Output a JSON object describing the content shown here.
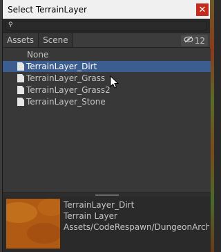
{
  "window": {
    "title": "Select TerrainLayer",
    "close_glyph": "✕"
  },
  "search": {
    "icon": "search-icon",
    "value": "",
    "placeholder": ""
  },
  "tabs": [
    {
      "label": "Assets",
      "active": true
    },
    {
      "label": "Scene",
      "active": false
    }
  ],
  "visibility": {
    "icon": "eye-slash-icon",
    "count": "12"
  },
  "items": [
    {
      "label": "None",
      "has_icon": false,
      "selected": false
    },
    {
      "label": "TerrainLayer_Dirt",
      "has_icon": true,
      "selected": true
    },
    {
      "label": "TerrainLayer_Grass",
      "has_icon": true,
      "selected": false
    },
    {
      "label": "TerrainLayer_Grass2",
      "has_icon": true,
      "selected": false
    },
    {
      "label": "TerrainLayer_Stone",
      "has_icon": true,
      "selected": false
    }
  ],
  "preview": {
    "name": "TerrainLayer_Dirt",
    "type": "Terrain Layer",
    "path": "Assets/CodeRespawn/DungeonArchi"
  },
  "colors": {
    "selection": "#3b5d8f",
    "close": "#c42b1c",
    "thumb": "#b05a14"
  }
}
